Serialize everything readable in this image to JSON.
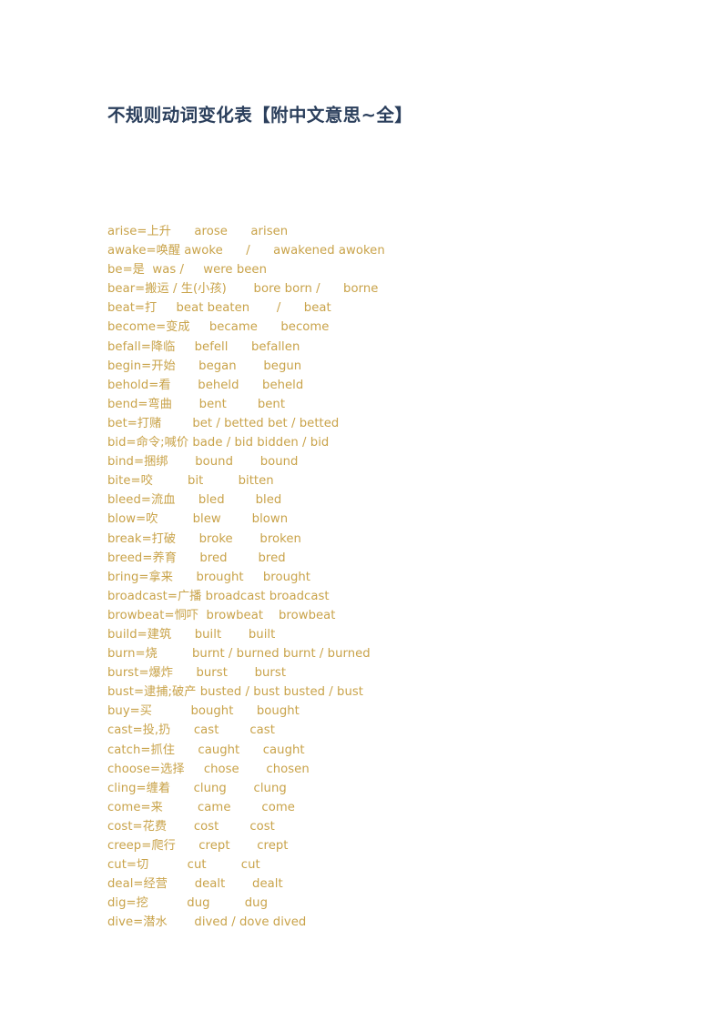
{
  "document": {
    "title": "不规则动词变化表【附中文意思~全】",
    "text_color": "#c9a34a",
    "title_color": "#2b3f5c",
    "background_color": "#ffffff"
  },
  "verbs": [
    {
      "line": "arise=上升      arose      arisen"
    },
    {
      "line": "awake=唤醒 awoke      /      awakened awoken"
    },
    {
      "line": "be=是  was /     were been"
    },
    {
      "line": "bear=搬运 / 生(小孩)       bore born /      borne"
    },
    {
      "line": "beat=打     beat beaten       /      beat"
    },
    {
      "line": "become=变成     became      become"
    },
    {
      "line": "befall=降临     befell      befallen"
    },
    {
      "line": "begin=开始      began       begun"
    },
    {
      "line": "behold=看       beheld      beheld"
    },
    {
      "line": "bend=弯曲       bent        bent"
    },
    {
      "line": "bet=打赌        bet / betted bet / betted"
    },
    {
      "line": "bid=命令;喊价 bade / bid bidden / bid"
    },
    {
      "line": "bind=捆绑       bound       bound"
    },
    {
      "line": "bite=咬         bit         bitten"
    },
    {
      "line": "bleed=流血      bled        bled"
    },
    {
      "line": "blow=吹         blew        blown"
    },
    {
      "line": "break=打破      broke       broken"
    },
    {
      "line": "breed=养育      bred        bred"
    },
    {
      "line": "bring=拿来      brought     brought"
    },
    {
      "line": "broadcast=广播 broadcast broadcast"
    },
    {
      "line": "browbeat=恫吓  browbeat    browbeat"
    },
    {
      "line": "build=建筑      built       built"
    },
    {
      "line": "burn=烧         burnt / burned burnt / burned"
    },
    {
      "line": "burst=爆炸      burst       burst"
    },
    {
      "line": "bust=逮捕;破产 busted / bust busted / bust"
    },
    {
      "line": "buy=买          bought      bought"
    },
    {
      "line": "cast=投,扔      cast        cast"
    },
    {
      "line": "catch=抓住      caught      caught"
    },
    {
      "line": "choose=选择     chose       chosen"
    },
    {
      "line": "cling=缠着      clung       clung"
    },
    {
      "line": "come=来         came        come"
    },
    {
      "line": "cost=花费       cost        cost"
    },
    {
      "line": "creep=爬行      crept       crept"
    },
    {
      "line": "cut=切          cut         cut"
    },
    {
      "line": "deal=经营       dealt       dealt"
    },
    {
      "line": "dig=挖          dug         dug"
    },
    {
      "line": "dive=潜水       dived / dove dived"
    }
  ]
}
